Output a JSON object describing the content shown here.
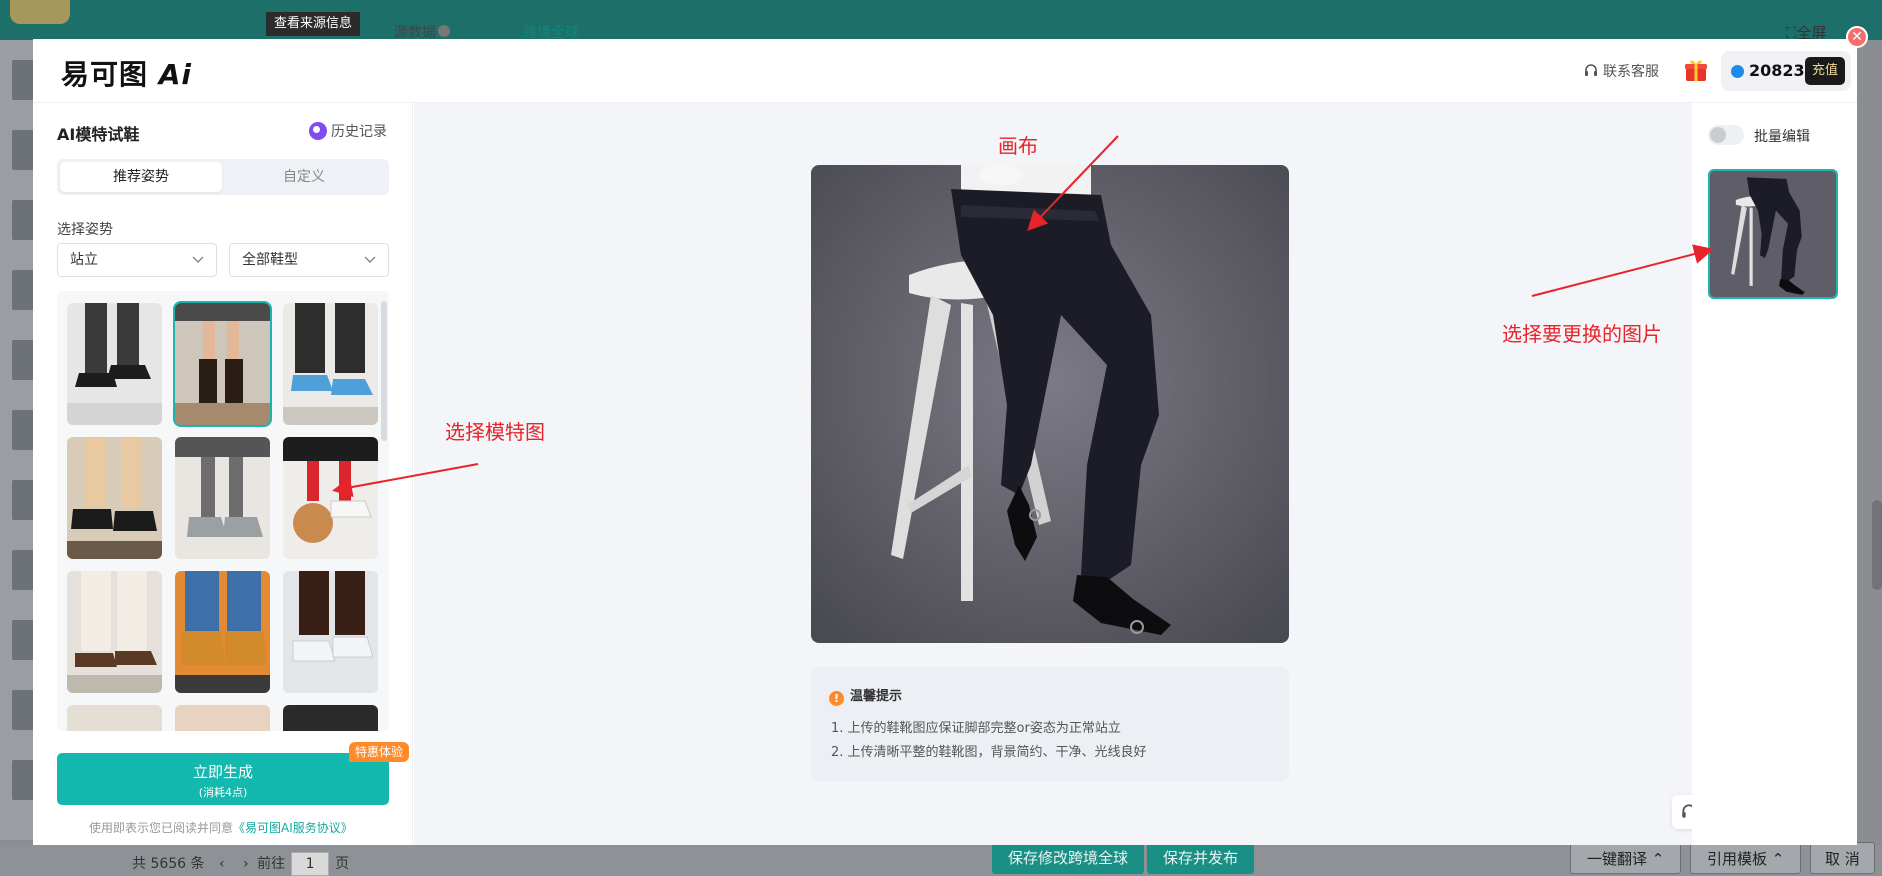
{
  "background": {
    "source_tag": "查看来源信息",
    "tabs": [
      "源数据",
      "跨境全球"
    ],
    "fullscreen": "全屏",
    "pager": {
      "total": "共 5656 条",
      "goto": "前往",
      "page": "1",
      "page_suffix": "页"
    },
    "buttons": [
      "保存修改跨境全球",
      "保存并发布",
      "一键翻译",
      "引用模板",
      "取 消"
    ]
  },
  "header": {
    "brand": "易可图",
    "brand_ai": "Ai",
    "support": "联系客服",
    "points": "20823",
    "recharge": "充值"
  },
  "left_panel": {
    "title": "AI模特试鞋",
    "history": "历史记录",
    "tabs": [
      "推荐姿势",
      "自定义"
    ],
    "pose_label": "选择姿势",
    "pose_select": "站立",
    "type_select": "全部鞋型",
    "generate_label": "立即生成",
    "generate_cost": "(消耗4点)",
    "promo_badge": "特惠体验",
    "agreement_prefix": "使用即表示您已阅读并同意",
    "agreement_link": "《易可图AI服务协议》"
  },
  "center": {
    "tips_title": "温馨提示",
    "tips": [
      "1. 上传的鞋靴图应保证脚部完整or姿态为正常站立",
      "2. 上传清晰平整的鞋靴图，背景简约、干净、光线良好"
    ]
  },
  "right_panel": {
    "batch_edit": "批量编辑"
  },
  "annotations": {
    "canvas": "画布",
    "model": "选择模特图",
    "replace": "选择要更换的图片"
  },
  "colors": {
    "accent": "#13b9ae",
    "annotation": "#e8242a",
    "promo": "#ff8a2a"
  }
}
